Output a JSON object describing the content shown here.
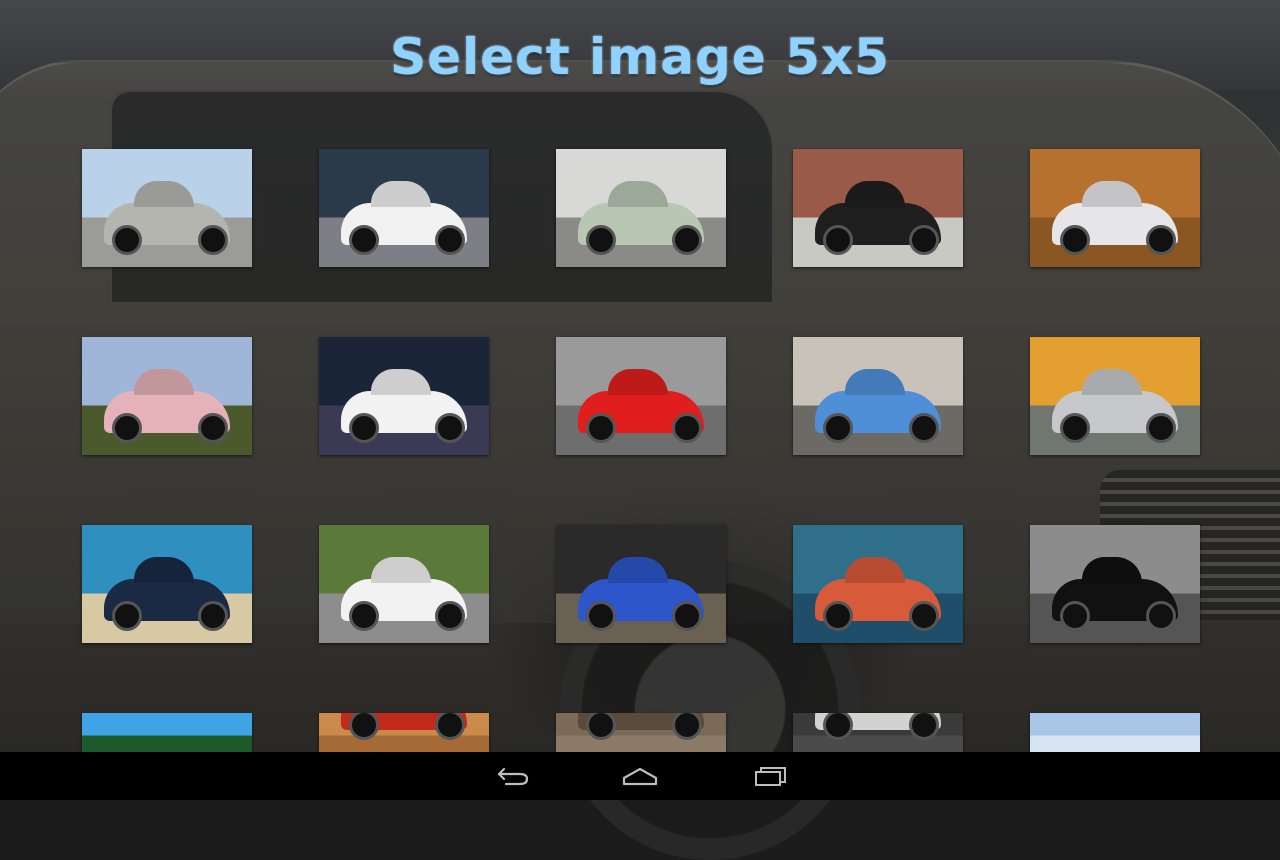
{
  "page": {
    "title": "Select image 5x5",
    "title_color": "#8fd2ff"
  },
  "images": [
    {
      "name": "silver-sports-coupe",
      "sky": "#b9d2ea",
      "ground": "#9b9b98",
      "car": "#b5b5b0"
    },
    {
      "name": "white-corvette-rear",
      "sky": "#2b3a4a",
      "ground": "#7c7f85",
      "car": "#f1f1f1"
    },
    {
      "name": "pale-green-trabant",
      "sky": "#d8d8d6",
      "ground": "#8a8a88",
      "car": "#b7c7b3"
    },
    {
      "name": "black-vintage-porsche",
      "sky": "#9a5a48",
      "ground": "#c9c9c4",
      "car": "#1e1e1e"
    },
    {
      "name": "rally-car-dust",
      "sky": "#b7712f",
      "ground": "#8a5622",
      "car": "#e6e6ea"
    },
    {
      "name": "pink-classic-sedan",
      "sky": "#9fb6d8",
      "ground": "#4a5a2c",
      "car": "#e4b2b8"
    },
    {
      "name": "white-mercedes-amg",
      "sky": "#1b2538",
      "ground": "#3a3a55",
      "car": "#f2f2f2"
    },
    {
      "name": "red-ferrari-street",
      "sky": "#9a9a9a",
      "ground": "#6e6e6e",
      "car": "#e11e1e"
    },
    {
      "name": "blue-bmw-street",
      "sky": "#c9c2b8",
      "ground": "#6d6a66",
      "car": "#4f8fd7"
    },
    {
      "name": "silver-audi-r8-sunset",
      "sky": "#e3a030",
      "ground": "#6f7770",
      "car": "#c6c8cc"
    },
    {
      "name": "blue-fiat-500-beach",
      "sky": "#2f8fbf",
      "ground": "#d7c9a4",
      "car": "#1a2a45"
    },
    {
      "name": "green-twizy",
      "sky": "#5b7a3a",
      "ground": "#8d8d8d",
      "car": "#f2f2f2"
    },
    {
      "name": "blue-subaru-rally",
      "sky": "#2a2a2a",
      "ground": "#6a6152",
      "car": "#2c56c9"
    },
    {
      "name": "classic-chevy-front",
      "sky": "#2f6f8a",
      "ground": "#1f4e6a",
      "car": "#d75a3a"
    },
    {
      "name": "nascar-39",
      "sky": "#8c8c8c",
      "ground": "#555555",
      "car": "#111111"
    },
    {
      "name": "palm-trees",
      "sky": "#3fa4e6",
      "ground": "#1e5a2a",
      "car": "#3fa4e6"
    },
    {
      "name": "red-car-desert",
      "sky": "#c98a4a",
      "ground": "#a56a36",
      "car": "#c12a1a"
    },
    {
      "name": "old-building-street",
      "sky": "#7b6a58",
      "ground": "#8a7a66",
      "car": "#5a4a3a"
    },
    {
      "name": "alley-car",
      "sky": "#3a3a3a",
      "ground": "#4b4b4b",
      "car": "#d2d2d2"
    },
    {
      "name": "cloudy-sky",
      "sky": "#a9c6e8",
      "ground": "#d7e4f0",
      "car": "#a9c6e8"
    }
  ],
  "navbar": {
    "back_icon": "back-icon",
    "home_icon": "home-icon",
    "recents_icon": "recents-icon"
  }
}
